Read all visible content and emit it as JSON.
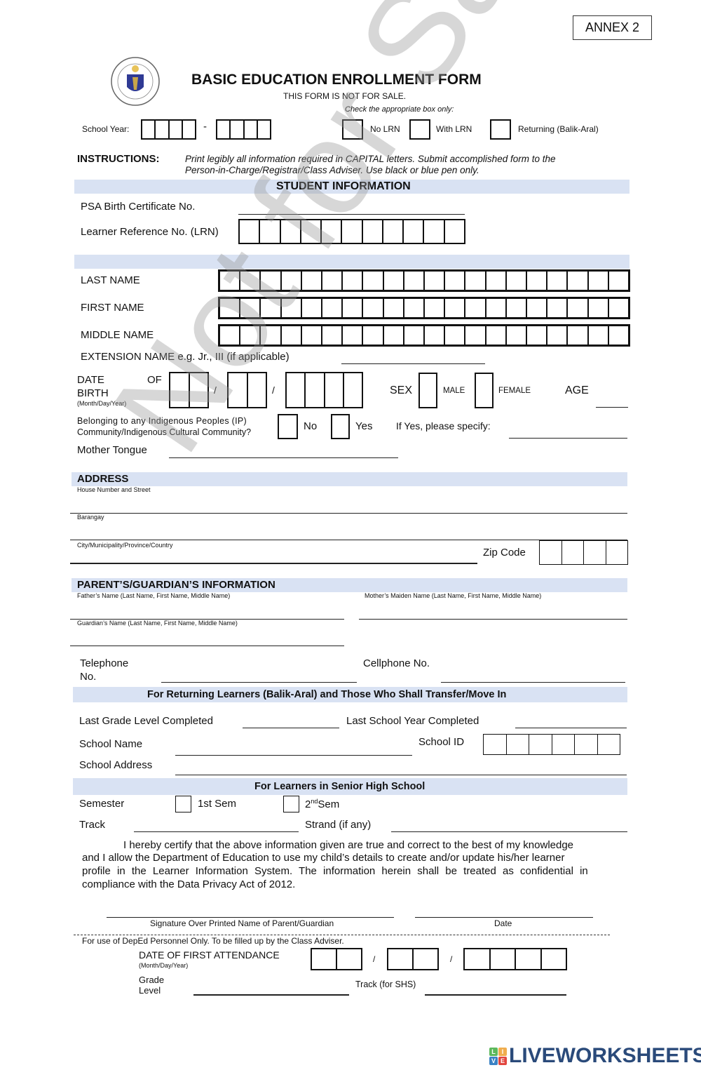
{
  "annex": "ANNEX 2",
  "header": {
    "title": "BASIC EDUCATION ENROLLMENT FORM",
    "subtitle": "THIS FORM IS NOT FOR SALE.",
    "check_hint": "Check the appropriate box only:",
    "school_year_label": "School Year:",
    "school_year_sep": "-",
    "options": [
      "No LRN",
      "With LRN",
      "Returning (Balik-Aral)"
    ]
  },
  "instructions": {
    "label": "INSTRUCTIONS:",
    "line1": "Print legibly all information required in CAPITAL letters. Submit accomplished form to the",
    "line2": "Person-in-Charge/Registrar/Class Adviser. Use black or blue pen only."
  },
  "student": {
    "heading": "STUDENT INFORMATION",
    "psa_label": "PSA Birth Certificate No.",
    "lrn_label": "Learner Reference No. (LRN)",
    "last_name": "LAST NAME",
    "first_name": "FIRST NAME",
    "middle_name": "MIDDLE NAME",
    "extension": "EXTENSION NAME e.g. Jr., III (if applicable)",
    "dob_1": "DATE",
    "dob_of": "OF",
    "dob_2": "BIRTH",
    "dob_hint": "(Month/Day/Year)",
    "slash": "/",
    "sex": "SEX",
    "male": "MALE",
    "female": "FEMALE",
    "age": "AGE",
    "ip_line1": "Belonging to any Indigenous Peoples (IP)",
    "ip_line2": "Community/Indigenous Cultural Community?",
    "no": "No",
    "yes": "Yes",
    "if_yes": "If Yes, please specify:",
    "mother_tongue": "Mother Tongue"
  },
  "address": {
    "heading": "ADDRESS",
    "house": "House Number and Street",
    "barangay": "Barangay",
    "city": "City/Municipality/Province/Country",
    "zip": "Zip Code"
  },
  "parent": {
    "heading": "PARENT’S/GUARDIAN’S INFORMATION",
    "father": "Father’s Name (Last Name, First Name, Middle Name)",
    "mother": "Mother’s Maiden Name (Last Name, First Name, Middle Name)",
    "guardian": "Guardian’s Name (Last Name, First Name, Middle Name)",
    "telephone_1": "Telephone",
    "telephone_2": "No.",
    "cellphone": "Cellphone No."
  },
  "returning": {
    "heading": "For Returning Learners (Balik-Aral) and Those Who Shall Transfer/Move In",
    "last_grade": "Last Grade Level Completed",
    "last_sy": "Last School Year Completed",
    "school_name": "School Name",
    "school_id": "School ID",
    "school_address": "School Address"
  },
  "shs": {
    "heading": "For Learners in Senior High School",
    "semester": "Semester",
    "sem1": "1st Sem",
    "sem2_num": "2",
    "sem2_sup": "nd",
    "sem2_word": "Sem",
    "track": "Track",
    "strand": "Strand (if any)"
  },
  "certification": {
    "line1": "I hereby certify that the above information given are true and correct to the best of my knowledge",
    "line2": "and I allow the Department of Education to use my child’s details to create and/or update his/her learner",
    "line3": "profile in the Learner Information System. The information herein shall be treated as confidential in",
    "line4": "compliance with the Data Privacy Act of 2012.",
    "signature": "Signature Over Printed Name of Parent/Guardian",
    "date": "Date"
  },
  "deped": {
    "note": "For use of DepEd Personnel Only. To be filled up by the Class Adviser.",
    "first_attendance": "DATE OF FIRST ATTENDANCE",
    "hint": "(Month/Day/Year)",
    "slash": "/",
    "grade_1": "Grade",
    "grade_2": "Level",
    "track_shs": "Track (for SHS)"
  },
  "watermark": "Not for Sale",
  "branding": {
    "logo_letters": [
      "L",
      "I",
      "V",
      "E"
    ],
    "logo_colors": [
      "#5cb85c",
      "#f0ad4e",
      "#3b82c4",
      "#e2463f"
    ],
    "name": "LIVEWORKSHEETS"
  }
}
